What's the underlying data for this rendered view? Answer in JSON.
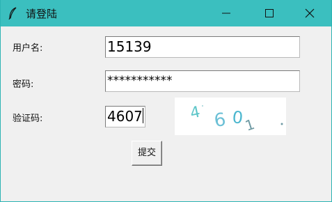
{
  "window": {
    "title": "请登陆",
    "accent_color": "#3bbfbf",
    "icon": "feather-icon",
    "controls": [
      "minimize-icon",
      "maximize-icon",
      "close-icon"
    ]
  },
  "form": {
    "username": {
      "label": "用户名:",
      "value": "15139"
    },
    "password": {
      "label": "密码:",
      "value": "***********"
    },
    "captcha": {
      "label": "验证码:",
      "value": "4607",
      "image_text": "4601"
    },
    "submit_label": "提交"
  }
}
